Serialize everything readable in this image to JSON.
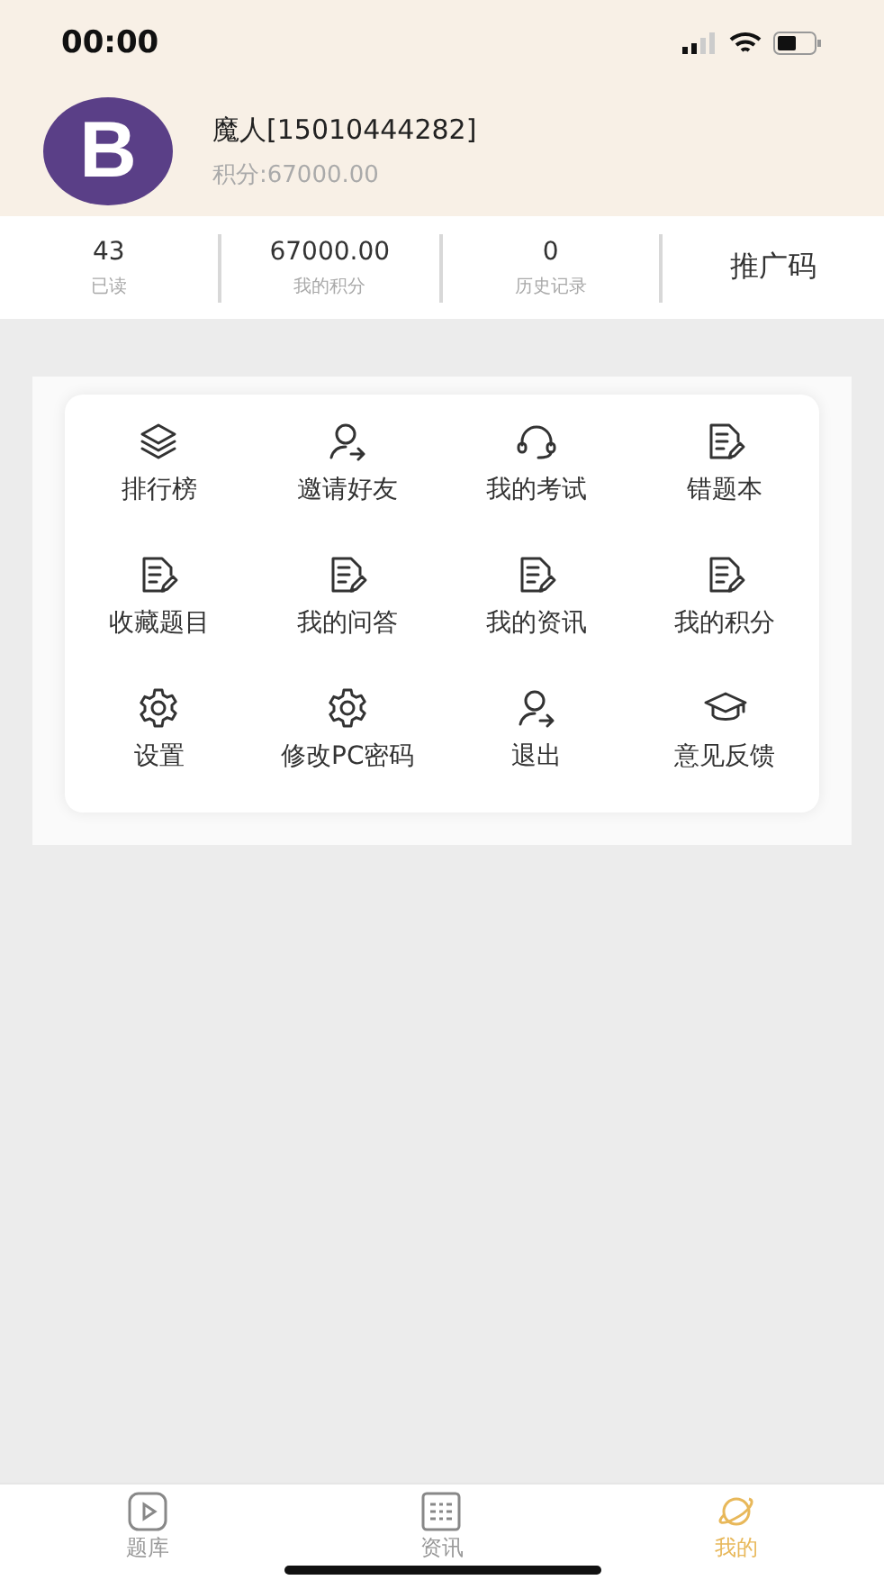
{
  "status_bar": {
    "time": "00:00"
  },
  "profile": {
    "avatar_letter": "B",
    "name": "魔人[15010444282]",
    "points": "积分:67000.00"
  },
  "stats": [
    {
      "kind": "stat",
      "value": "43",
      "label": "已读"
    },
    {
      "kind": "stat",
      "value": "67000.00",
      "label": "我的积分"
    },
    {
      "kind": "stat",
      "value": "0",
      "label": "历史记录"
    },
    {
      "kind": "link",
      "label": "推广码"
    }
  ],
  "menu": [
    {
      "kind": "layers",
      "label": "排行榜"
    },
    {
      "kind": "user-arrow",
      "label": "邀请好友"
    },
    {
      "kind": "headset",
      "label": "我的考试"
    },
    {
      "kind": "note",
      "label": "错题本"
    },
    {
      "kind": "note",
      "label": "收藏题目"
    },
    {
      "kind": "note",
      "label": "我的问答"
    },
    {
      "kind": "note",
      "label": "我的资讯"
    },
    {
      "kind": "note",
      "label": "我的积分"
    },
    {
      "kind": "gear",
      "label": "设置"
    },
    {
      "kind": "gear",
      "label": "修改PC密码"
    },
    {
      "kind": "user-arrow",
      "label": "退出"
    },
    {
      "kind": "cap",
      "label": "意见反馈"
    }
  ],
  "tab_bar": [
    {
      "kind": "play",
      "label": "题库",
      "selected": false
    },
    {
      "kind": "grid",
      "label": "资讯",
      "selected": false
    },
    {
      "kind": "planet",
      "label": "我的",
      "selected": true
    }
  ]
}
